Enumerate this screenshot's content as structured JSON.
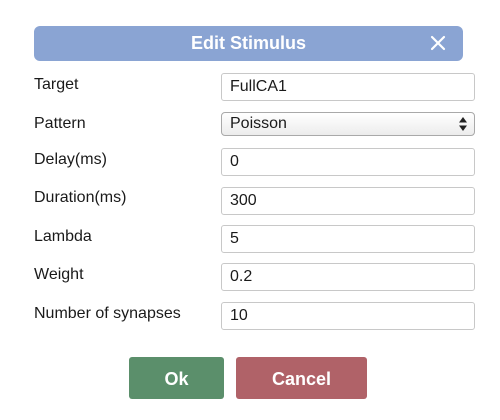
{
  "dialog": {
    "title": "Edit Stimulus",
    "close_icon": "close-icon"
  },
  "fields": {
    "target": {
      "label": "Target",
      "value": "FullCA1"
    },
    "pattern": {
      "label": "Pattern",
      "value": "Poisson"
    },
    "delay": {
      "label": "Delay(ms)",
      "value": "0"
    },
    "duration": {
      "label": "Duration(ms)",
      "value": "300"
    },
    "lambda": {
      "label": "Lambda",
      "value": "5"
    },
    "weight": {
      "label": "Weight",
      "value": "0.2"
    },
    "synapses": {
      "label": "Number of synapses",
      "value": "10"
    }
  },
  "buttons": {
    "ok": "Ok",
    "cancel": "Cancel"
  },
  "colors": {
    "title_bar": "#8aa4d3",
    "ok_button": "#5b8f6b",
    "cancel_button": "#b06268"
  }
}
